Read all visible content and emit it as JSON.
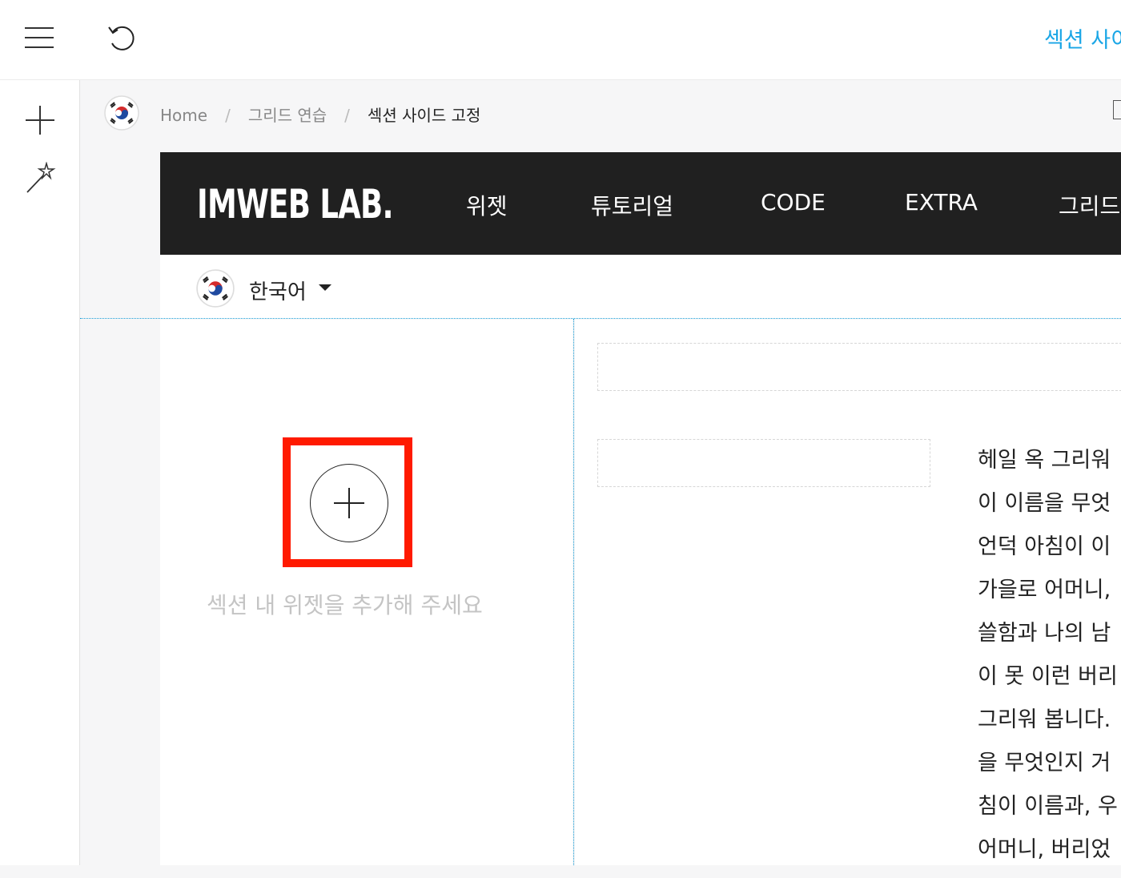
{
  "toolbar": {
    "menu_icon": "hamburger-menu-icon",
    "undo_icon": "undo-icon",
    "section_title": "섹션 사이"
  },
  "leftrail": {
    "add_icon": "plus-icon",
    "design_icon": "magic-wand-icon"
  },
  "breadcrumb": {
    "flag_icon": "korea-flag-icon",
    "items": [
      "Home",
      "그리드 연습",
      "섹션 사이드 고정"
    ],
    "separator": "/"
  },
  "site": {
    "logo": "IMWEB LAB.",
    "nav": [
      "위젯",
      "튜토리얼",
      "CODE",
      "EXTRA",
      "그리드"
    ],
    "language": "한국어"
  },
  "section": {
    "add_widget_icon": "circle-plus-icon",
    "empty_hint": "섹션 내 위젯을 추가해 주세요",
    "body_lines": [
      "헤일 옥 그리워",
      "이 이름을 무엇",
      "언덕 아침이 이",
      "가을로 어머니,",
      "쓸함과 나의 남",
      "이 못 이런 버리",
      "그리워 봅니다.",
      "을 무엇인지 거",
      "침이 이름과, 우",
      "어머니, 버리었"
    ]
  },
  "colors": {
    "accent": "#1aa6e6",
    "header_bg": "#202020",
    "highlight": "#ff1a00"
  }
}
